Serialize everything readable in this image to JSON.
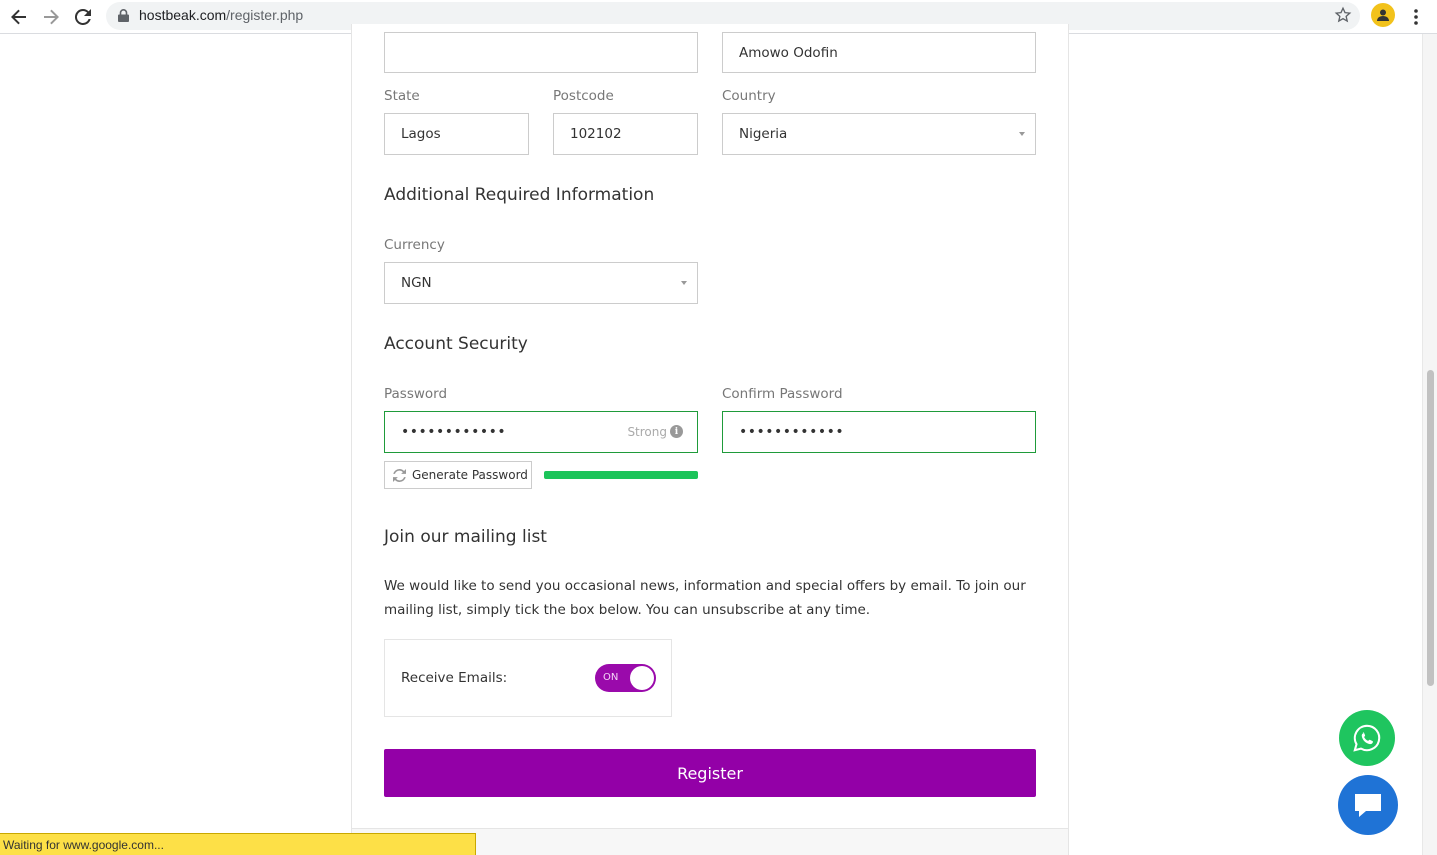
{
  "browser": {
    "url_host": "hostbeak.com",
    "url_path": "/register.php"
  },
  "address": {
    "address2_value": "",
    "city_value": "Amowo Odofin",
    "state_label": "State",
    "state_value": "Lagos",
    "postcode_label": "Postcode",
    "postcode_value": "102102",
    "country_label": "Country",
    "country_value": "Nigeria"
  },
  "additional": {
    "heading": "Additional Required Information",
    "currency_label": "Currency",
    "currency_value": "NGN"
  },
  "security": {
    "heading": "Account Security",
    "password_label": "Password",
    "password_value": "••••••••••••",
    "strength_text": "Strong",
    "confirm_label": "Confirm Password",
    "confirm_value": "••••••••••••",
    "generate_label": "Generate Password",
    "strength_level": 1.0
  },
  "mailing": {
    "heading": "Join our mailing list",
    "description": "We would like to send you occasional news, information and special offers by email. To join our mailing list, simply tick the box below. You can unsubscribe at any time.",
    "receive_label": "Receive Emails:",
    "toggle_text": "ON"
  },
  "register_label": "Register",
  "status_bar": "Waiting for www.google.com...",
  "colors": {
    "brand_purple": "#9300a7",
    "valid_green": "#1f9b3a",
    "whatsapp_green": "#1fc55f",
    "chat_blue": "#1f73d6",
    "status_yellow": "#fde047"
  },
  "icons": [
    "back-arrow-icon",
    "forward-arrow-icon",
    "reload-icon",
    "lock-icon",
    "star-icon",
    "profile-icon",
    "kebab-menu-icon",
    "info-icon",
    "refresh-icon",
    "whatsapp-icon",
    "chat-bubble-icon"
  ]
}
